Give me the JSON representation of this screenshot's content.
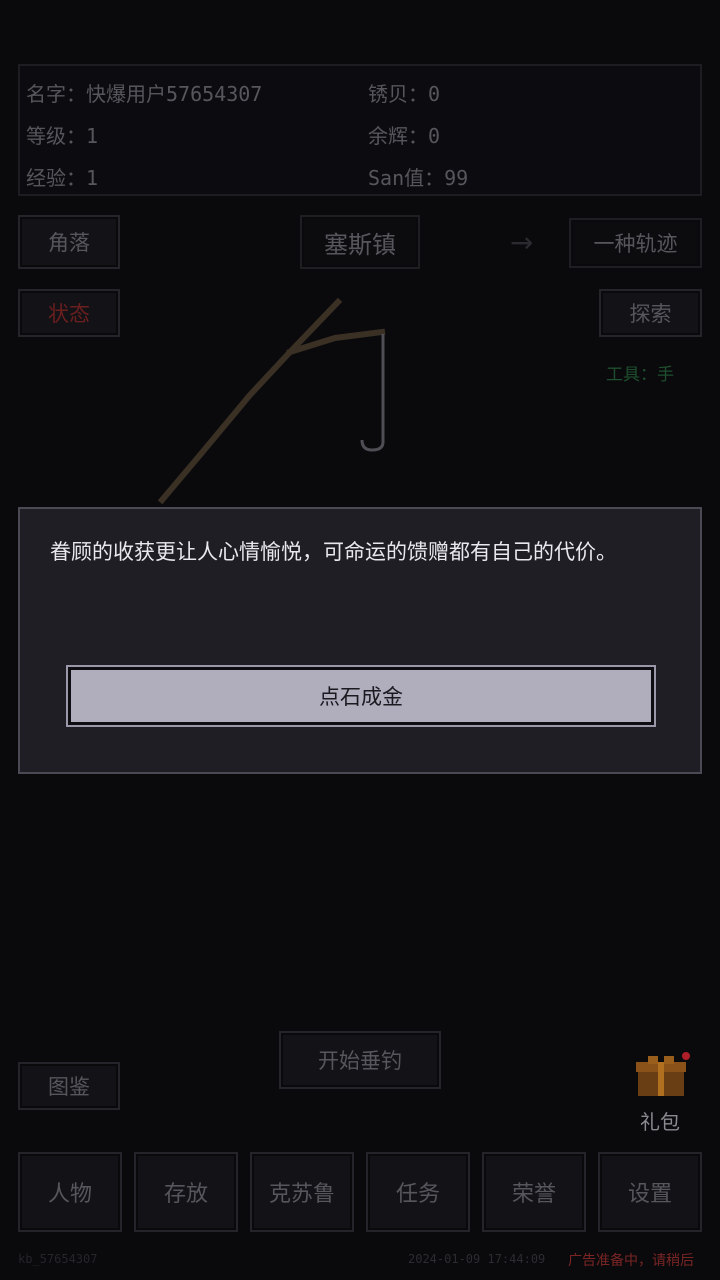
{
  "stats": {
    "name": "名字：快爆用户57654307",
    "rust_shell": "锈贝：0",
    "level": "等级：1",
    "afterglow": "余辉：0",
    "exp": "经验：1",
    "san": "San值：99"
  },
  "nav": {
    "corner": "角落",
    "town": "塞斯镇",
    "arrow": "→",
    "trail": "一种轨迹",
    "status": "状态",
    "explore": "探索",
    "tool": "工具：手"
  },
  "dialog": {
    "text": "眷顾的收获更让人心情愉悦，可命运的馈赠都有自己的代价。",
    "button": "点石成金"
  },
  "actions": {
    "start_fishing": "开始垂钓",
    "encyclopedia": "图鉴",
    "gift": "礼包"
  },
  "bottom_nav": [
    {
      "label": "人物"
    },
    {
      "label": "存放"
    },
    {
      "label": "克苏鲁"
    },
    {
      "label": "任务"
    },
    {
      "label": "荣誉"
    },
    {
      "label": "设置"
    }
  ],
  "footer": {
    "user_id": "kb_57654307",
    "timestamp": "2024-01-09 17:44:09",
    "ad_status": "广告准备中，请稍后"
  },
  "colors": {
    "background": "#0a0a0d",
    "dialog_bg": "#1f1e25",
    "status_red": "#6a1e1e",
    "tool_green": "#1f4f2e",
    "ad_red": "#7a2424"
  }
}
